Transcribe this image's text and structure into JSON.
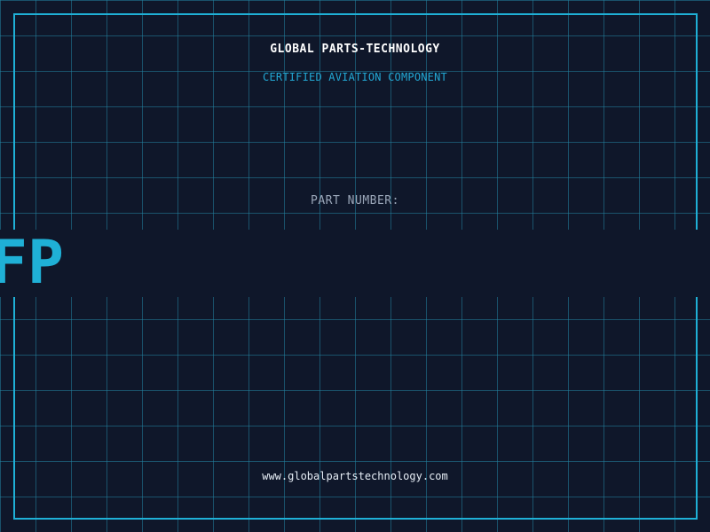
{
  "header": {
    "company_name": "GLOBAL PARTS-TECHNOLOGY",
    "tagline": "CERTIFIED AVIATION COMPONENT"
  },
  "part": {
    "label": "PART NUMBER:",
    "number_visible": "FP"
  },
  "footer": {
    "website": "www.globalpartstechnology.com"
  },
  "colors": {
    "background": "#0f172a",
    "accent": "#1fb0d6",
    "grid": "#2284a0",
    "label_gray": "#9aa6b8",
    "text_white": "#ffffff"
  }
}
